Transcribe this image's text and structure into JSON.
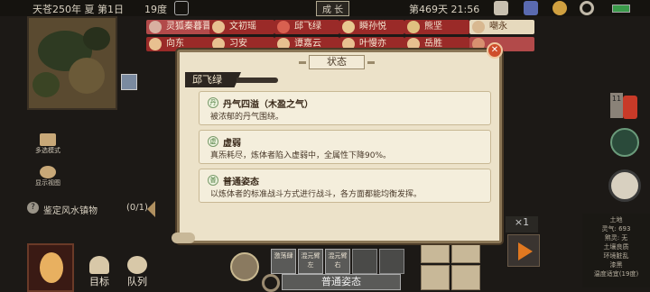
{
  "topbar": {
    "date": "天苍250年 夏 第1日",
    "temperature": "19度",
    "mode": "成 长",
    "day": "第469天 21:56"
  },
  "characters": [
    {
      "name": "灵狐秦暮晋",
      "style": "pink"
    },
    {
      "name": "文初瑶",
      "style": "red"
    },
    {
      "name": "邱飞绿",
      "style": "red"
    },
    {
      "name": "瞬孙悦",
      "style": "red"
    },
    {
      "name": "熊坚",
      "style": "red"
    },
    {
      "name": "嘲永",
      "style": "pale"
    },
    {
      "name": "向东",
      "style": "red"
    },
    {
      "name": "习安",
      "style": "red"
    },
    {
      "name": "谭嘉云",
      "style": "red"
    },
    {
      "name": "叶慢亦",
      "style": "red"
    },
    {
      "name": "岳胜",
      "style": "red"
    },
    {
      "name": "",
      "style": "pink"
    }
  ],
  "left_tools": {
    "tool1": "多选模式",
    "tool2": "显示视图",
    "task_label": "鉴定风水镇物",
    "task_count": "(0/1)",
    "task_q": "?"
  },
  "bottom": {
    "target": "目标",
    "queue": "队列",
    "posture": "普通姿态",
    "skill1": "激荡肆",
    "skill2": "混元臂左",
    "skill3": "混元臂右",
    "speed": "×1"
  },
  "modal": {
    "title": "状态",
    "close": "✕",
    "character": "邱飞绿",
    "statuses": [
      {
        "name": "丹气四溢（木盈之气）",
        "desc": "被浓郁的丹气围绕。",
        "icon": "丹"
      },
      {
        "name": "虚弱",
        "desc": "真炁耗尽，炼体者陷入虚弱中，全属性下降90%。",
        "icon": "虚"
      },
      {
        "name": "普通姿态",
        "desc": "以炼体者的标准战斗方式进行战斗，各方面都能均衡发挥。",
        "icon": "普"
      }
    ]
  },
  "right_info": {
    "line1": "土地",
    "line2": "灵气: 693",
    "line3": "煞灵: 无",
    "line4": "土壤良质",
    "line5": "环境脏乱",
    "line6": "漆黑",
    "line7": "温度适宜(19度)",
    "badge": "11"
  }
}
